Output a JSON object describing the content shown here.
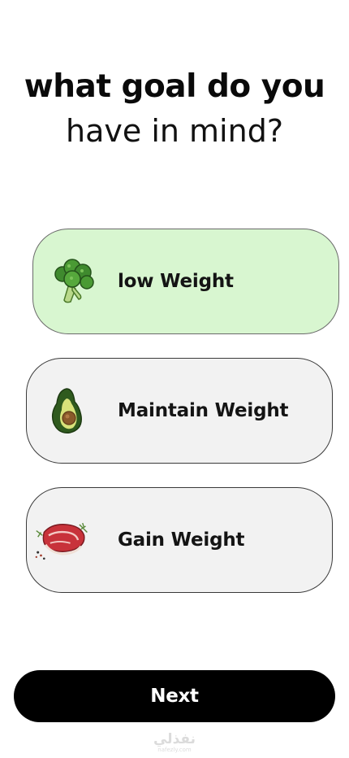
{
  "title": {
    "line1": "what goal do you",
    "line2": "have in mind?"
  },
  "options": [
    {
      "label": "low Weight",
      "icon": "broccoli-icon",
      "selected": true
    },
    {
      "label": "Maintain Weight",
      "icon": "avocado-icon",
      "selected": false
    },
    {
      "label": "Gain Weight",
      "icon": "steak-icon",
      "selected": false
    }
  ],
  "next_button": {
    "label": "Next"
  },
  "watermark": {
    "text": "نفذلي",
    "subtext": "nafezly.com"
  },
  "colors": {
    "selected_bg": "#d8f6d0",
    "option_bg": "#f2f2f2",
    "button_bg": "#000000",
    "button_text": "#ffffff"
  }
}
